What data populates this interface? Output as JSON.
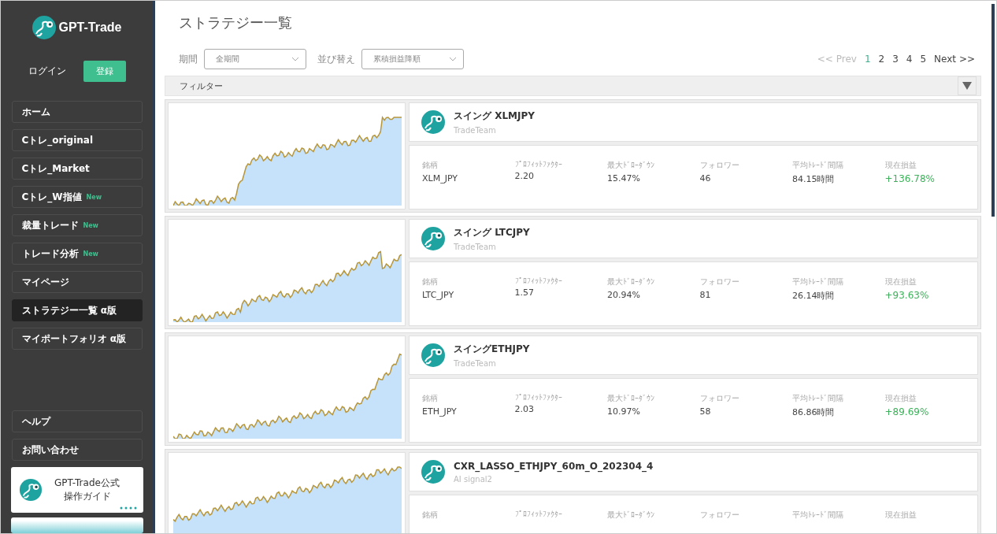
{
  "sidebar": {
    "logo": "GPT-Trade",
    "login": "ログイン",
    "register": "登録",
    "items": [
      {
        "label": "ホーム",
        "selected": false
      },
      {
        "label": "Cトレ_original",
        "selected": false
      },
      {
        "label": "Cトレ_Market",
        "selected": false
      },
      {
        "label": "Cトレ_W指値",
        "badge": "New",
        "selected": false
      },
      {
        "label": "裁量トレード",
        "badge": "New",
        "selected": false
      },
      {
        "label": "トレード分析",
        "badge": "New",
        "selected": false
      },
      {
        "label": "マイページ",
        "selected": false
      },
      {
        "label": "ストラテジー一覧 α版",
        "selected": true
      },
      {
        "label": "マイポートフォリオ α版",
        "selected": false
      }
    ],
    "bottom_items": [
      {
        "label": "ヘルプ"
      },
      {
        "label": "お問い合わせ"
      }
    ],
    "guide": {
      "line1": "GPT-Trade公式",
      "line2": "操作ガイド"
    }
  },
  "page": {
    "title": "ストラテジー一覧",
    "period": {
      "label": "期間",
      "value": "全期間"
    },
    "sort": {
      "label": "並び替え",
      "value": "累積損益降順"
    },
    "pagination": {
      "prev": {
        "label": "<< Prev",
        "disabled": true
      },
      "pages": [
        {
          "label": "1",
          "selected": true
        },
        {
          "label": "2",
          "selected": false
        },
        {
          "label": "3",
          "selected": false
        },
        {
          "label": "4",
          "selected": false
        },
        {
          "label": "5",
          "selected": false
        }
      ],
      "next": {
        "label": "Next >>",
        "disabled": false
      }
    },
    "filter": {
      "label": "フィルター"
    },
    "strategies": [
      {
        "name": "スイング XLMJPY",
        "author": "TradeTeam",
        "stats": [
          {
            "label": "銘柄",
            "value": "XLM_JPY",
            "kind": "plain"
          },
          {
            "label": "ﾌﾟﾛﾌｨｯﾄﾌｧｸﾀｰ",
            "value": "2.20",
            "kind": "plain"
          },
          {
            "label": "最大ﾄﾞﾛｰﾀﾞｳﾝ",
            "value": "15.47%",
            "kind": "plain"
          },
          {
            "label": "フォロワー",
            "value": "46",
            "kind": "plain"
          },
          {
            "label": "平均ﾄﾚｰﾄﾞ間隔",
            "value": "84.15時間",
            "kind": "plain"
          },
          {
            "label": "現在損益",
            "value": "+136.78%",
            "kind": "profit"
          }
        ]
      },
      {
        "name": "スイング LTCJPY",
        "author": "TradeTeam",
        "stats": [
          {
            "label": "銘柄",
            "value": "LTC_JPY",
            "kind": "plain"
          },
          {
            "label": "ﾌﾟﾛﾌｨｯﾄﾌｧｸﾀｰ",
            "value": "1.57",
            "kind": "plain"
          },
          {
            "label": "最大ﾄﾞﾛｰﾀﾞｳﾝ",
            "value": "20.94%",
            "kind": "plain"
          },
          {
            "label": "フォロワー",
            "value": "81",
            "kind": "plain"
          },
          {
            "label": "平均ﾄﾚｰﾄﾞ間隔",
            "value": "26.14時間",
            "kind": "plain"
          },
          {
            "label": "現在損益",
            "value": "+93.63%",
            "kind": "profit"
          }
        ]
      },
      {
        "name": "スイングETHJPY",
        "author": "TradeTeam",
        "stats": [
          {
            "label": "銘柄",
            "value": "ETH_JPY",
            "kind": "plain"
          },
          {
            "label": "ﾌﾟﾛﾌｨｯﾄﾌｧｸﾀｰ",
            "value": "2.03",
            "kind": "plain"
          },
          {
            "label": "最大ﾄﾞﾛｰﾀﾞｳﾝ",
            "value": "10.97%",
            "kind": "plain"
          },
          {
            "label": "フォロワー",
            "value": "58",
            "kind": "plain"
          },
          {
            "label": "平均ﾄﾚｰﾄﾞ間隔",
            "value": "86.86時間",
            "kind": "plain"
          },
          {
            "label": "現在損益",
            "value": "+89.69%",
            "kind": "profit"
          }
        ]
      },
      {
        "name": "CXR_LASSO_ETHJPY_60m_O_202304_4",
        "author": "AI signal2",
        "stats": [
          {
            "label": "銘柄"
          },
          {
            "label": "ﾌﾟﾛﾌｨｯﾄﾌｧｸﾀｰ"
          },
          {
            "label": "最大ﾄﾞﾛｰﾀﾞｳﾝ"
          },
          {
            "label": "フォロワー"
          },
          {
            "label": "平均ﾄﾚｰﾄﾞ間隔"
          },
          {
            "label": "現在損益"
          }
        ]
      }
    ]
  }
}
